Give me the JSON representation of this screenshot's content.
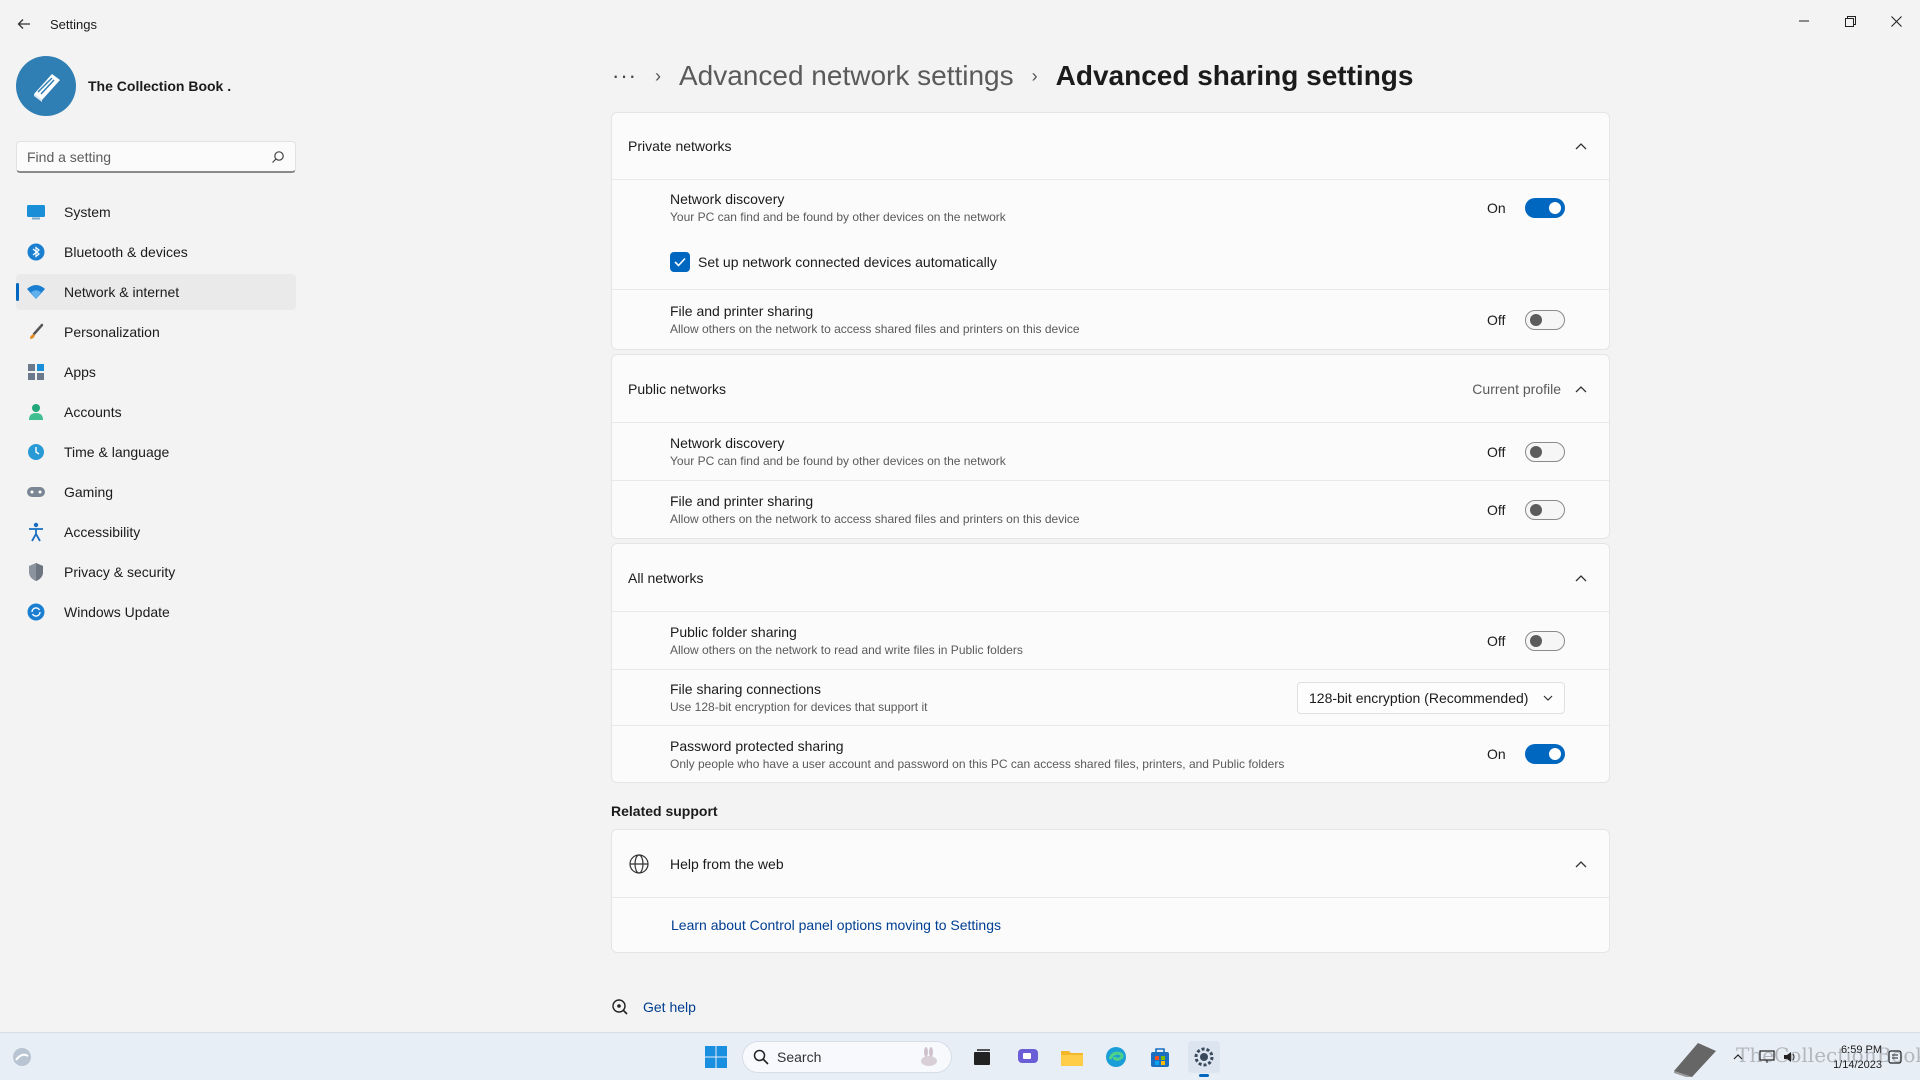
{
  "window": {
    "title": "Settings",
    "controls": [
      "minimize",
      "restore",
      "close"
    ]
  },
  "profile": {
    "name": "The Collection Book ."
  },
  "search": {
    "placeholder": "Find a setting"
  },
  "sidebar": {
    "items": [
      {
        "label": "System",
        "icon": "monitor-icon"
      },
      {
        "label": "Bluetooth & devices",
        "icon": "bluetooth-icon"
      },
      {
        "label": "Network & internet",
        "icon": "wifi-icon",
        "active": true
      },
      {
        "label": "Personalization",
        "icon": "brush-icon"
      },
      {
        "label": "Apps",
        "icon": "apps-icon"
      },
      {
        "label": "Accounts",
        "icon": "person-icon"
      },
      {
        "label": "Time & language",
        "icon": "clock-globe-icon"
      },
      {
        "label": "Gaming",
        "icon": "gamepad-icon"
      },
      {
        "label": "Accessibility",
        "icon": "accessibility-icon"
      },
      {
        "label": "Privacy & security",
        "icon": "shield-icon"
      },
      {
        "label": "Windows Update",
        "icon": "update-icon"
      }
    ]
  },
  "breadcrumb": {
    "more": "···",
    "parent": "Advanced network settings",
    "current": "Advanced sharing settings"
  },
  "private_networks": {
    "title": "Private networks",
    "network_discovery": {
      "title": "Network discovery",
      "desc": "Your PC can find and be found by other devices on the network",
      "state": "On"
    },
    "auto_setup": {
      "label": "Set up network connected devices automatically",
      "checked": true
    },
    "file_printer": {
      "title": "File and printer sharing",
      "desc": "Allow others on the network to access shared files and printers on this device",
      "state": "Off"
    }
  },
  "public_networks": {
    "title": "Public networks",
    "tag": "Current profile",
    "network_discovery": {
      "title": "Network discovery",
      "desc": "Your PC can find and be found by other devices on the network",
      "state": "Off"
    },
    "file_printer": {
      "title": "File and printer sharing",
      "desc": "Allow others on the network to access shared files and printers on this device",
      "state": "Off"
    }
  },
  "all_networks": {
    "title": "All networks",
    "public_folder": {
      "title": "Public folder sharing",
      "desc": "Allow others on the network to read and write files in Public folders",
      "state": "Off"
    },
    "file_connections": {
      "title": "File sharing connections",
      "desc": "Use 128-bit encryption for devices that support it",
      "selected": "128-bit encryption (Recommended)"
    },
    "password_sharing": {
      "title": "Password protected sharing",
      "desc": "Only people who have a user account and password on this PC can access shared files, printers, and Public folders",
      "state": "On"
    }
  },
  "related_support": {
    "title": "Related support",
    "help_web": "Help from the web",
    "link": "Learn about Control panel options moving to Settings"
  },
  "get_help": "Get help",
  "taskbar": {
    "search_label": "Search",
    "time": "6:59 PM",
    "date": "1/14/2023"
  },
  "watermark": "TheCollectionBook",
  "colors": {
    "accent": "#0067c0",
    "link": "#003e92",
    "background": "#f3f3f3",
    "card": "#fbfbfb"
  }
}
